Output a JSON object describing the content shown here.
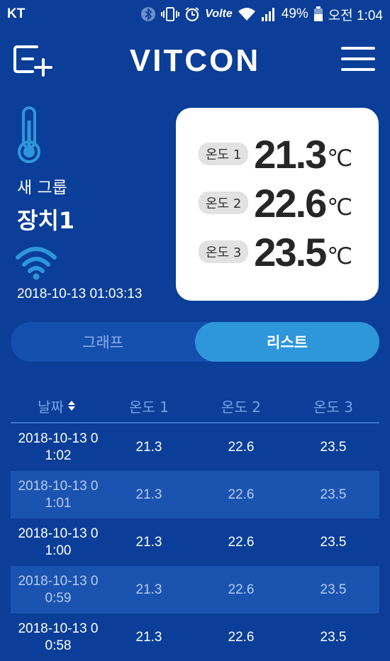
{
  "status_bar": {
    "carrier": "KT",
    "network": "Volte",
    "battery": "49%",
    "time": "오전 1:04"
  },
  "header": {
    "logo": "VITCON"
  },
  "device": {
    "group": "새 그룹",
    "name": "장치1",
    "timestamp": "2018-10-13 01:03:13"
  },
  "readings": [
    {
      "label": "온도 1",
      "value": "21.3",
      "unit": "℃"
    },
    {
      "label": "온도 2",
      "value": "22.6",
      "unit": "℃"
    },
    {
      "label": "온도 3",
      "value": "23.5",
      "unit": "℃"
    }
  ],
  "tabs": {
    "graph": "그래프",
    "list": "리스트",
    "active": "list"
  },
  "table": {
    "headers": [
      "날짜",
      "온도 1",
      "온도 2",
      "온도 3"
    ],
    "rows": [
      {
        "date_line1": "2018-10-13 0",
        "date_line2": "1:02",
        "t1": "21.3",
        "t2": "22.6",
        "t3": "23.5"
      },
      {
        "date_line1": "2018-10-13 0",
        "date_line2": "1:01",
        "t1": "21.3",
        "t2": "22.6",
        "t3": "23.5"
      },
      {
        "date_line1": "2018-10-13 0",
        "date_line2": "1:00",
        "t1": "21.3",
        "t2": "22.6",
        "t3": "23.5"
      },
      {
        "date_line1": "2018-10-13 0",
        "date_line2": "0:59",
        "t1": "21.3",
        "t2": "22.6",
        "t3": "23.5"
      },
      {
        "date_line1": "2018-10-13 0",
        "date_line2": "0:58",
        "t1": "21.3",
        "t2": "22.6",
        "t3": "23.5"
      }
    ]
  },
  "colors": {
    "background": "#0a3e98",
    "tab_active": "#2e97db",
    "row_alt": "#1b53b0",
    "header_text": "#6fa8ea"
  }
}
